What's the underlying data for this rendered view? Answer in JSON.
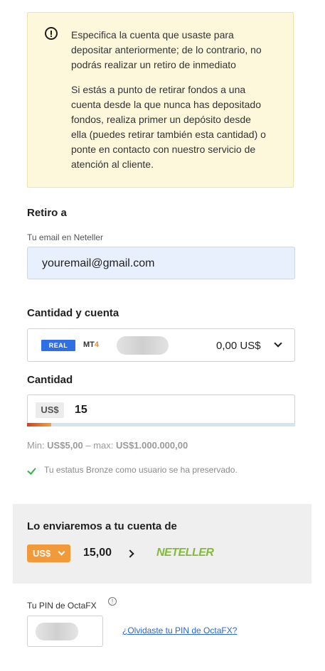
{
  "warning": {
    "paragraph1": [
      "Especifica la cuenta que usaste para",
      "depositar anteriormente; de lo contrario, no",
      "podrás realizar un retiro de inmediato"
    ],
    "paragraph2": [
      "Si estás a punto de retirar fondos a una",
      "cuenta desde la que nunca has depositado",
      "fondos, realiza primer un depósito desde",
      "ella (puedes retirar también esta cantidad) o",
      "ponte en contacto con nuestro servicio de",
      "atención al cliente."
    ]
  },
  "withdraw_to": {
    "title": "Retiro a",
    "email_label": "Tu email en Neteller",
    "email_value": "youremail@gmail.com"
  },
  "account": {
    "title": "Cantidad y cuenta",
    "badge": "REAL",
    "platform_prefix": "MT",
    "platform_suffix": "4",
    "balance": "0,00 US$"
  },
  "amount": {
    "title": "Cantidad",
    "currency": "US$",
    "value": "15",
    "progress_fraction": 0.09,
    "limits_prefix": "Min: ",
    "min": "US$5,00",
    "limits_mid": " – max: ",
    "max": "US$1.000.000,00",
    "status_text": "Tu estatus Bronze como usuario se ha preservado."
  },
  "send": {
    "title": "Lo enviaremos a tu cuenta de",
    "currency": "US$",
    "amount": "15,00",
    "provider": "NETELLER"
  },
  "pin": {
    "label": "Tu PIN de OctaFX",
    "info_icon": "!",
    "forgot_link": "¿Olvidaste tu PIN de OctaFX?"
  },
  "colors": {
    "warning_bg": "#fdf7dc",
    "email_field_bg": "#e8f0fe",
    "real_badge": "#2e6fe6",
    "currency_button": "#f29a3a",
    "neteller_green": "#83ba3b",
    "link": "#2a66d8",
    "success_check": "#3cb043"
  },
  "icons": [
    "alert-circle-icon",
    "chevron-down-icon",
    "check-icon",
    "chevron-right-icon",
    "info-icon"
  ]
}
